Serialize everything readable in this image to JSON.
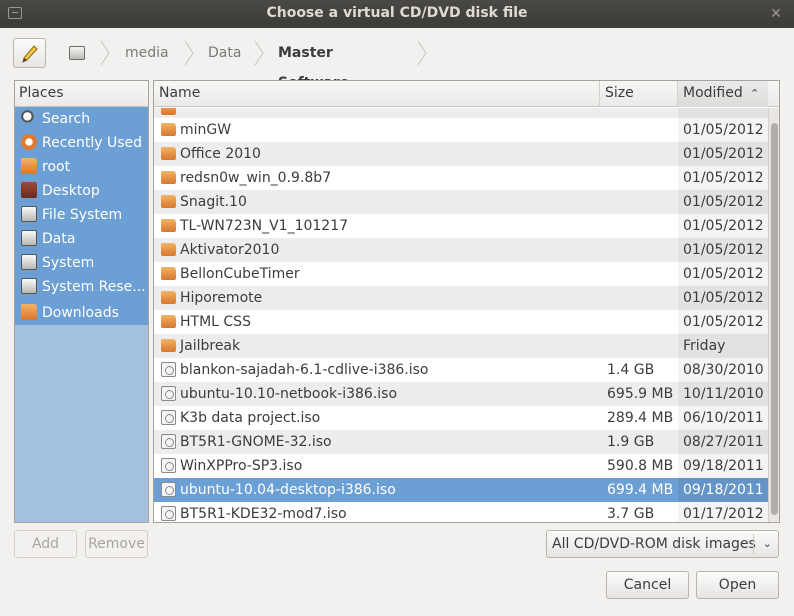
{
  "window": {
    "title": "Choose a virtual CD/DVD disk file"
  },
  "pathbar": {
    "crumbs": [
      "media",
      "Data",
      "Master Software"
    ]
  },
  "places": {
    "header": "Places",
    "items": [
      {
        "label": "Search",
        "icon": "search-icon"
      },
      {
        "label": "Recently Used",
        "icon": "recent-icon"
      },
      {
        "label": "root",
        "icon": "home-folder-icon"
      },
      {
        "label": "Desktop",
        "icon": "desktop-icon"
      },
      {
        "label": "File System",
        "icon": "drive-icon"
      },
      {
        "label": "Data",
        "icon": "drive-icon"
      },
      {
        "label": "System",
        "icon": "drive-icon"
      },
      {
        "label": "System Rese...",
        "icon": "drive-icon"
      },
      {
        "label": "Downloads",
        "icon": "folder-icon"
      }
    ]
  },
  "filelist": {
    "columns": {
      "name": "Name",
      "size": "Size",
      "modified": "Modified"
    },
    "rows": [
      {
        "name": "minGW",
        "size": "",
        "modified": "01/05/2012",
        "type": "folder"
      },
      {
        "name": "Office 2010",
        "size": "",
        "modified": "01/05/2012",
        "type": "folder"
      },
      {
        "name": "redsn0w_win_0.9.8b7",
        "size": "",
        "modified": "01/05/2012",
        "type": "folder"
      },
      {
        "name": "Snagit.10",
        "size": "",
        "modified": "01/05/2012",
        "type": "folder"
      },
      {
        "name": "TL-WN723N_V1_101217",
        "size": "",
        "modified": "01/05/2012",
        "type": "folder"
      },
      {
        "name": "Aktivator2010",
        "size": "",
        "modified": "01/05/2012",
        "type": "folder"
      },
      {
        "name": "BellonCubeTimer",
        "size": "",
        "modified": "01/05/2012",
        "type": "folder"
      },
      {
        "name": "Hiporemote",
        "size": "",
        "modified": "01/05/2012",
        "type": "folder"
      },
      {
        "name": "HTML CSS",
        "size": "",
        "modified": "01/05/2012",
        "type": "folder"
      },
      {
        "name": "Jailbreak",
        "size": "",
        "modified": "Friday",
        "type": "folder"
      },
      {
        "name": "blankon-sajadah-6.1-cdlive-i386.iso",
        "size": "1.4 GB",
        "modified": "08/30/2010",
        "type": "disc"
      },
      {
        "name": "ubuntu-10.10-netbook-i386.iso",
        "size": "695.9 MB",
        "modified": "10/11/2010",
        "type": "disc"
      },
      {
        "name": "K3b data project.iso",
        "size": "289.4 MB",
        "modified": "06/10/2011",
        "type": "disc"
      },
      {
        "name": "BT5R1-GNOME-32.iso",
        "size": "1.9 GB",
        "modified": "08/27/2011",
        "type": "disc"
      },
      {
        "name": "WinXPPro-SP3.iso",
        "size": "590.8 MB",
        "modified": "09/18/2011",
        "type": "disc"
      },
      {
        "name": "ubuntu-10.04-desktop-i386.iso",
        "size": "699.4 MB",
        "modified": "09/18/2011",
        "type": "disc",
        "selected": true
      },
      {
        "name": "BT5R1-KDE32-mod7.iso",
        "size": "3.7 GB",
        "modified": "01/17/2012",
        "type": "disc"
      }
    ]
  },
  "buttons": {
    "add": "Add",
    "remove": "Remove",
    "cancel": "Cancel",
    "open": "Open"
  },
  "filter": {
    "selected": "All CD/DVD-ROM disk images"
  },
  "colors": {
    "selection": "#6c9fd4",
    "titlebar": "#3c3b37"
  }
}
